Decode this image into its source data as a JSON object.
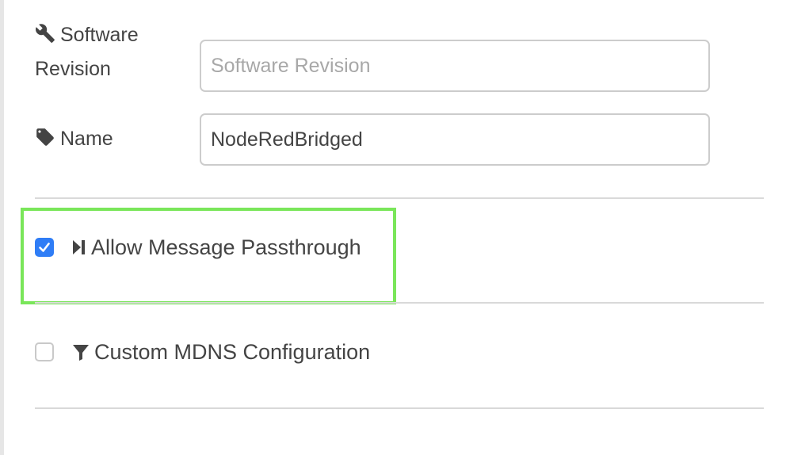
{
  "form": {
    "software_revision": {
      "label_line1": "Software",
      "label_line2": "Revision",
      "icon": "wrench-icon",
      "value": "",
      "placeholder": "Software Revision"
    },
    "name": {
      "label": "Name",
      "icon": "tag-icon",
      "value": "NodeRedBridged",
      "placeholder": ""
    },
    "allow_passthrough": {
      "label": "Allow Message Passthrough",
      "icon": "step-forward-icon",
      "checked": true
    },
    "custom_mdns": {
      "label": "Custom MDNS Configuration",
      "icon": "filter-icon",
      "checked": false
    }
  },
  "colors": {
    "checkbox_checked": "#2f7df6",
    "highlight_border": "#7ae65a",
    "text": "#444444",
    "placeholder": "#a8a8a8"
  }
}
